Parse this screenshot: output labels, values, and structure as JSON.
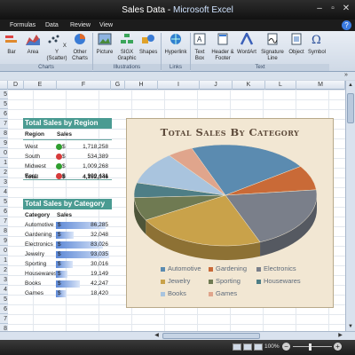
{
  "window": {
    "title": "Sales Data",
    "app_name": "Microsoft Excel",
    "title_sep": " - "
  },
  "window_controls": {
    "minimize": "–",
    "maximize": "▫",
    "close": "✕"
  },
  "tabs": [
    "Formulas",
    "Data",
    "Review",
    "View"
  ],
  "ribbon": {
    "buttons": [
      {
        "label": "Bar",
        "icon": "bar-chart-icon"
      },
      {
        "label": "Area",
        "icon": "area-chart-icon"
      },
      {
        "label": "X Y (Scatter)",
        "icon": "scatter-chart-icon"
      },
      {
        "label": "Other Charts",
        "icon": "other-charts-icon"
      },
      {
        "label": "Picture",
        "icon": "picture-icon"
      },
      {
        "label": "SIGX Graphic",
        "icon": "smartart-icon"
      },
      {
        "label": "Shapes",
        "icon": "shapes-icon"
      },
      {
        "label": "Hyperlink",
        "icon": "hyperlink-icon"
      },
      {
        "label": "Text Box",
        "icon": "text-box-icon"
      },
      {
        "label": "Header & Footer",
        "icon": "header-footer-icon"
      },
      {
        "label": "WordArt",
        "icon": "wordart-icon"
      },
      {
        "label": "Signature Line",
        "icon": "signature-line-icon"
      },
      {
        "label": "Object",
        "icon": "object-icon"
      },
      {
        "label": "Symbol",
        "icon": "symbol-icon"
      }
    ],
    "groups": [
      "Charts",
      "Illustrations",
      "Links",
      "Text"
    ]
  },
  "columns": [
    "D",
    "E",
    "F",
    "G",
    "H",
    "I",
    "J",
    "K",
    "L",
    "M"
  ],
  "rows": [
    "5",
    "5",
    "6",
    "7",
    "8",
    "9",
    "0",
    "1",
    "2",
    "3",
    "4",
    "5",
    "6",
    "7",
    "8",
    "9",
    "0",
    "1",
    "2",
    "3",
    "4",
    "5",
    "6",
    "7",
    "8"
  ],
  "region_table": {
    "title": "Total Sales by Region",
    "headers": [
      "Region",
      "Sales"
    ],
    "rows": [
      {
        "region": "West",
        "currency": "$",
        "sales": "1,718,258",
        "status": "green"
      },
      {
        "region": "South",
        "currency": "$",
        "sales": "534,389",
        "status": "red"
      },
      {
        "region": "Midwest",
        "currency": "$",
        "sales": "1,009,268",
        "status": "green"
      },
      {
        "region": "East",
        "currency": "$",
        "sales": "900,431",
        "status": "red"
      }
    ],
    "total_label": "Total",
    "total_currency": "$",
    "total_value": "4,162,346"
  },
  "category_table": {
    "title": "Total Sales by Category",
    "headers": [
      "Category",
      "Sales"
    ],
    "rows": [
      {
        "category": "Automotive",
        "currency": "$",
        "sales": "86,285",
        "bar": 0.93
      },
      {
        "category": "Gardening",
        "currency": "$",
        "sales": "32,048",
        "bar": 0.34
      },
      {
        "category": "Electronics",
        "currency": "$",
        "sales": "83,026",
        "bar": 0.89
      },
      {
        "category": "Jewelry",
        "currency": "$",
        "sales": "93,035",
        "bar": 1.0
      },
      {
        "category": "Sporting",
        "currency": "$",
        "sales": "30,016",
        "bar": 0.32
      },
      {
        "category": "Housewares",
        "currency": "$",
        "sales": "19,149",
        "bar": 0.21
      },
      {
        "category": "Books",
        "currency": "$",
        "sales": "42,247",
        "bar": 0.45
      },
      {
        "category": "Games",
        "currency": "$",
        "sales": "18,420",
        "bar": 0.2
      }
    ]
  },
  "chart_data": {
    "type": "pie",
    "title": "Total Sales By Category",
    "categories": [
      "Automotive",
      "Gardening",
      "Electronics",
      "Jewelry",
      "Sporting",
      "Housewares",
      "Books",
      "Games"
    ],
    "values": [
      86285,
      32048,
      83026,
      93035,
      30016,
      19149,
      42247,
      18420
    ],
    "colors": [
      "#5b8bb0",
      "#c96a37",
      "#7a7f8a",
      "#c9a24a",
      "#6f7a52",
      "#4e7e86",
      "#a9c4de",
      "#e0a58c"
    ],
    "legend_placement": "bottom"
  },
  "status": {
    "zoom": "100%",
    "zoom_out": "−",
    "zoom_in": "+"
  },
  "colors": {
    "table_header": "#4a9b92",
    "chart_bg": "#f2e7d3",
    "title_text": "#5d4a3a"
  }
}
